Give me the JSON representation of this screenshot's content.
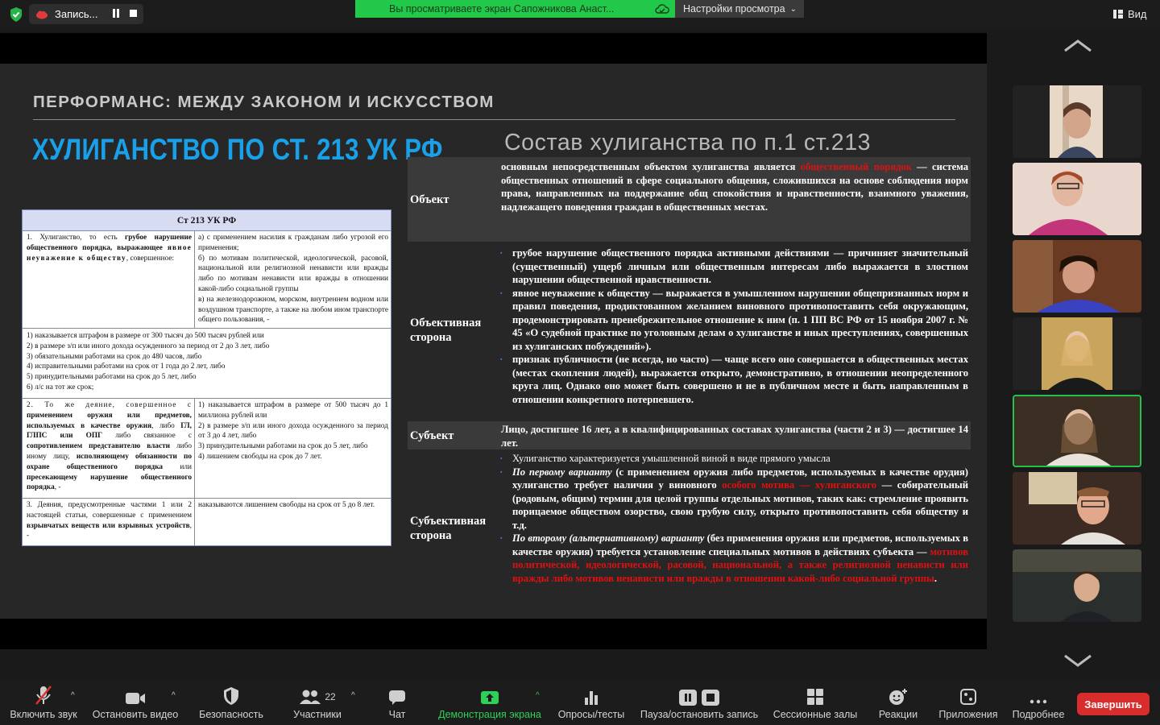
{
  "topbar": {
    "recording_label": "Запись...",
    "viewing_notice": "Вы просматриваете экран Сапожникова Анаст...",
    "view_options": "Настройки просмотра",
    "view_button": "Вид"
  },
  "slide": {
    "subtitle": "ПЕРФОРМАНС: МЕЖДУ ЗАКОНОМ И ИСКУССТВОМ",
    "title": "ХУЛИГАНСТВО ПО СТ. 213 УК РФ",
    "composition_title": "Состав хулиганства по п.1 ст.213"
  },
  "law": {
    "head": "Ст 213 УК РФ",
    "r1c1_a": "1. Хулиганство, то есть ",
    "r1c1_b": "грубое нарушение общественного порядка, выражающее ",
    "r1c1_c": "явное неуважение к обществу",
    "r1c1_d": ", совершенное:",
    "r1c2": [
      "а) с применением насилия к гражданам либо угрозой его применения;",
      "б) по мотивам политической, идеологической, расовой, национальной или религиозной ненависти или вражды либо по мотивам ненависти или вражды в отношении какой-либо социальной группы",
      "в) на железнодорожном, морском, внутреннем водном или воздушном транспорте, а также на любом ином транспорте общего пользования, -"
    ],
    "r2": [
      "1)    наказывается штрафом в размере от 300 тысяч до 500 тысяч рублей или",
      "2)    в размере з/п или иного дохода осужденного за период от 2 до 3 лет, либо",
      "3)    обязательными работами на срок до 480 часов, либо",
      "4)    исправительными работами на срок от 1 года до 2 лет, либо",
      "5)    принудительными работами на срок до 5 лет, либо",
      "6)    л/с на тот же срок;"
    ],
    "r3c1_a": "2. То же деяние, совершенное с ",
    "r3c1_b": "применением оружия или предметов, используемых в качестве оружия",
    "r3c1_c": ", либо ",
    "r3c1_d": "ГЛ, ГЛПС или ОПГ",
    "r3c1_e": " либо связанное с ",
    "r3c1_f": "сопротивлением представителю власти",
    "r3c1_g": " либо иному лицу, ",
    "r3c1_h": "исполняющему обязанности по охране общественного порядка",
    "r3c1_i": " или ",
    "r3c1_j": "пресекающему нарушение общественного порядка",
    "r3c1_k": ", -",
    "r3c2": [
      "1)  наказывается штрафом в размере от 500 тысяч до 1 миллиона рублей или",
      "2)  в размере з/п или иного дохода осужденного за период от 3 до 4 лет, либо",
      "3)  принудительными работами на срок до 5 лет, либо",
      "4)  лишением свободы на срок до 7 лет."
    ],
    "r4c1_a": "3. Деяния, предусмотренные частями 1 или 2 настоящей статьи, совершенные с применением ",
    "r4c1_b": "взрывчатых веществ или взрывных устройств",
    "r4c1_c": ", -",
    "r4c2": "наказываются лишением свободы на срок от 5 до 8 лет."
  },
  "composition": {
    "object_label": "Объект",
    "object_a": "основным непосредственным объектом хулиганства является ",
    "object_red": "общественный порядок",
    "object_b": " — система общественных отношений в сфере социального общения, сложившихся на основе соблюдения норм права, направленных на поддержание общ спокойствия и нравственности, взаимного уважения, надлежащего поведения граждан в общественных местах.",
    "objective_label": "Объективная сторона",
    "objective_b1": "грубое нарушение общественного порядка активными действиями — причиняет значительный (существенный) ущерб личным или общественным интересам либо выражается в злостном нарушении общественной нравственности.",
    "objective_b2": "явное неуважение к обществу — выражается в умышленном нарушении общепризнанных норм и правил поведения, продиктованном желанием виновного противопоставить себя окружающим, продемонстрировать пренебрежительное отношение к ним (п. 1 ПП ВС РФ от 15 ноября 2007 г. № 45 «О судебной практике по уголовным делам о хулиганстве и иных преступлениях, совершенных из хулиганских побуждений»).",
    "objective_b3": "признак публичности (не всегда, но часто) — чаще всего оно совершается в общественных местах (местах скопления людей), выражается открыто, демонстративно, в отношении неопределенного круга лиц. Однако оно может быть совершено и не в публичном месте и быть направленным в отношении конкретного потерпевшего.",
    "subject_label": "Субъект",
    "subject_text": "Лицо, достигшее 16 лет, а в квалифицированных составах хулиганства (части 2 и 3) — достигшее 14 лет.",
    "subjective_label": "Субъективная сторона",
    "subj_b1": "Хулиганство характеризуется умышленной виной в виде прямого умысла",
    "subj_b2_it": "По первому варианту",
    "subj_b2_a": " (с применением оружия либо предметов, используемых в качестве орудия) хулиганство требует наличия у виновного ",
    "subj_b2_red": "особого мотива — хулиганского",
    "subj_b2_b": " — собирательный (родовым, общим) термин для целой группы отдельных мотивов, таких как: стремление проявить порицаемое обществом озорство, свою грубую силу, открыто противопоставить себя обществу и т.д.",
    "subj_b3_it": "По второму (альтернативному) варианту",
    "subj_b3_a": " (без применения оружия или предметов, используемых в качестве оружия) требуется установление специальных мотивов в действиях субъекта — ",
    "subj_b3_red": "мотивов политической, идеологической, расовой, национальной, а также религиозной ненависти или вражды либо мотивов ненависти или вражды в отношении какой-либо социальной группы",
    "subj_b3_b": "."
  },
  "toolbar": {
    "mute": "Включить звук",
    "video": "Остановить видео",
    "security": "Безопасность",
    "participants": "Участники",
    "participants_count": "22",
    "chat": "Чат",
    "share": "Демонстрация экрана",
    "polls": "Опросы/тесты",
    "pause_rec": "Пауза/остановить запись",
    "breakout": "Сессионные залы",
    "reactions": "Реакции",
    "apps": "Приложения",
    "more": "Подробнее",
    "end": "Завершить"
  },
  "colors": {
    "accent_green": "#24c14e",
    "slide_title_blue": "#1aa0e8",
    "end_red": "#d92c2c"
  }
}
